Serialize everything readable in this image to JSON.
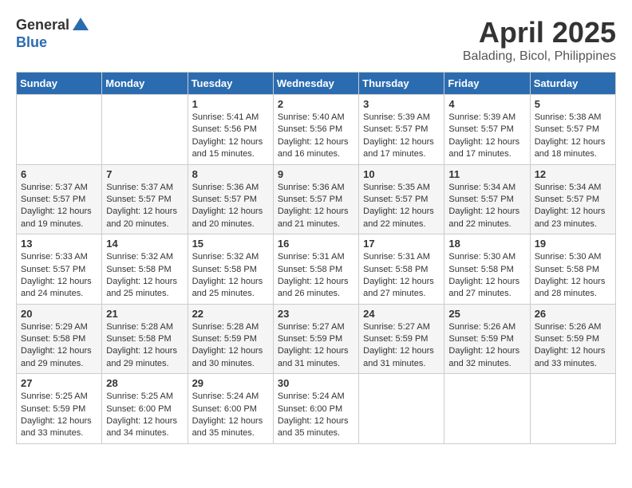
{
  "logo": {
    "general": "General",
    "blue": "Blue"
  },
  "title": "April 2025",
  "location": "Balading, Bicol, Philippines",
  "days_of_week": [
    "Sunday",
    "Monday",
    "Tuesday",
    "Wednesday",
    "Thursday",
    "Friday",
    "Saturday"
  ],
  "weeks": [
    [
      {
        "day": "",
        "info": ""
      },
      {
        "day": "",
        "info": ""
      },
      {
        "day": "1",
        "info": "Sunrise: 5:41 AM\nSunset: 5:56 PM\nDaylight: 12 hours and 15 minutes."
      },
      {
        "day": "2",
        "info": "Sunrise: 5:40 AM\nSunset: 5:56 PM\nDaylight: 12 hours and 16 minutes."
      },
      {
        "day": "3",
        "info": "Sunrise: 5:39 AM\nSunset: 5:57 PM\nDaylight: 12 hours and 17 minutes."
      },
      {
        "day": "4",
        "info": "Sunrise: 5:39 AM\nSunset: 5:57 PM\nDaylight: 12 hours and 17 minutes."
      },
      {
        "day": "5",
        "info": "Sunrise: 5:38 AM\nSunset: 5:57 PM\nDaylight: 12 hours and 18 minutes."
      }
    ],
    [
      {
        "day": "6",
        "info": "Sunrise: 5:37 AM\nSunset: 5:57 PM\nDaylight: 12 hours and 19 minutes."
      },
      {
        "day": "7",
        "info": "Sunrise: 5:37 AM\nSunset: 5:57 PM\nDaylight: 12 hours and 20 minutes."
      },
      {
        "day": "8",
        "info": "Sunrise: 5:36 AM\nSunset: 5:57 PM\nDaylight: 12 hours and 20 minutes."
      },
      {
        "day": "9",
        "info": "Sunrise: 5:36 AM\nSunset: 5:57 PM\nDaylight: 12 hours and 21 minutes."
      },
      {
        "day": "10",
        "info": "Sunrise: 5:35 AM\nSunset: 5:57 PM\nDaylight: 12 hours and 22 minutes."
      },
      {
        "day": "11",
        "info": "Sunrise: 5:34 AM\nSunset: 5:57 PM\nDaylight: 12 hours and 22 minutes."
      },
      {
        "day": "12",
        "info": "Sunrise: 5:34 AM\nSunset: 5:57 PM\nDaylight: 12 hours and 23 minutes."
      }
    ],
    [
      {
        "day": "13",
        "info": "Sunrise: 5:33 AM\nSunset: 5:57 PM\nDaylight: 12 hours and 24 minutes."
      },
      {
        "day": "14",
        "info": "Sunrise: 5:32 AM\nSunset: 5:58 PM\nDaylight: 12 hours and 25 minutes."
      },
      {
        "day": "15",
        "info": "Sunrise: 5:32 AM\nSunset: 5:58 PM\nDaylight: 12 hours and 25 minutes."
      },
      {
        "day": "16",
        "info": "Sunrise: 5:31 AM\nSunset: 5:58 PM\nDaylight: 12 hours and 26 minutes."
      },
      {
        "day": "17",
        "info": "Sunrise: 5:31 AM\nSunset: 5:58 PM\nDaylight: 12 hours and 27 minutes."
      },
      {
        "day": "18",
        "info": "Sunrise: 5:30 AM\nSunset: 5:58 PM\nDaylight: 12 hours and 27 minutes."
      },
      {
        "day": "19",
        "info": "Sunrise: 5:30 AM\nSunset: 5:58 PM\nDaylight: 12 hours and 28 minutes."
      }
    ],
    [
      {
        "day": "20",
        "info": "Sunrise: 5:29 AM\nSunset: 5:58 PM\nDaylight: 12 hours and 29 minutes."
      },
      {
        "day": "21",
        "info": "Sunrise: 5:28 AM\nSunset: 5:58 PM\nDaylight: 12 hours and 29 minutes."
      },
      {
        "day": "22",
        "info": "Sunrise: 5:28 AM\nSunset: 5:59 PM\nDaylight: 12 hours and 30 minutes."
      },
      {
        "day": "23",
        "info": "Sunrise: 5:27 AM\nSunset: 5:59 PM\nDaylight: 12 hours and 31 minutes."
      },
      {
        "day": "24",
        "info": "Sunrise: 5:27 AM\nSunset: 5:59 PM\nDaylight: 12 hours and 31 minutes."
      },
      {
        "day": "25",
        "info": "Sunrise: 5:26 AM\nSunset: 5:59 PM\nDaylight: 12 hours and 32 minutes."
      },
      {
        "day": "26",
        "info": "Sunrise: 5:26 AM\nSunset: 5:59 PM\nDaylight: 12 hours and 33 minutes."
      }
    ],
    [
      {
        "day": "27",
        "info": "Sunrise: 5:25 AM\nSunset: 5:59 PM\nDaylight: 12 hours and 33 minutes."
      },
      {
        "day": "28",
        "info": "Sunrise: 5:25 AM\nSunset: 6:00 PM\nDaylight: 12 hours and 34 minutes."
      },
      {
        "day": "29",
        "info": "Sunrise: 5:24 AM\nSunset: 6:00 PM\nDaylight: 12 hours and 35 minutes."
      },
      {
        "day": "30",
        "info": "Sunrise: 5:24 AM\nSunset: 6:00 PM\nDaylight: 12 hours and 35 minutes."
      },
      {
        "day": "",
        "info": ""
      },
      {
        "day": "",
        "info": ""
      },
      {
        "day": "",
        "info": ""
      }
    ]
  ]
}
